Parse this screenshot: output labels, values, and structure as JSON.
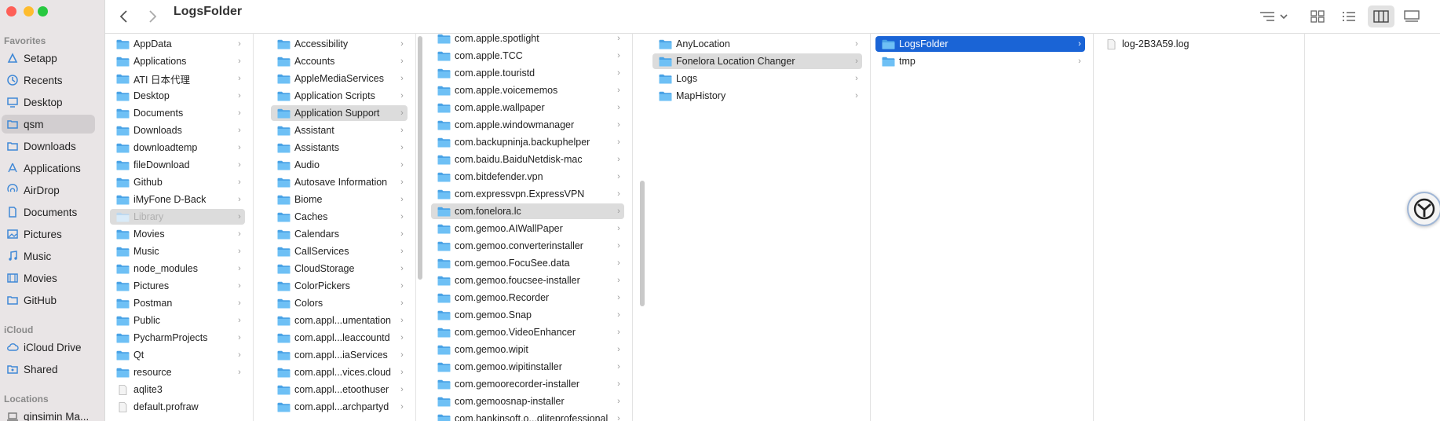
{
  "window": {
    "title": "LogsFolder"
  },
  "sidebar": {
    "favorites_label": "Favorites",
    "favorites": [
      {
        "label": "Setapp",
        "icon": "setapp-icon"
      },
      {
        "label": "Recents",
        "icon": "clock-icon"
      },
      {
        "label": "Desktop",
        "icon": "desktop-icon"
      },
      {
        "label": "qsm",
        "icon": "folder-icon",
        "selected": true
      },
      {
        "label": "Downloads",
        "icon": "folder-icon"
      },
      {
        "label": "Applications",
        "icon": "applications-icon"
      },
      {
        "label": "AirDrop",
        "icon": "airdrop-icon"
      },
      {
        "label": "Documents",
        "icon": "document-icon"
      },
      {
        "label": "Pictures",
        "icon": "picture-icon"
      },
      {
        "label": "Music",
        "icon": "music-icon"
      },
      {
        "label": "Movies",
        "icon": "movie-icon"
      },
      {
        "label": "GitHub",
        "icon": "folder-icon"
      }
    ],
    "icloud_label": "iCloud",
    "icloud": [
      {
        "label": "iCloud Drive",
        "icon": "cloud-icon"
      },
      {
        "label": "Shared",
        "icon": "shared-folder-icon"
      }
    ],
    "locations_label": "Locations",
    "locations": [
      {
        "label": "qinsimin Ma...",
        "icon": "laptop-icon"
      }
    ]
  },
  "columns": [
    {
      "items": [
        {
          "label": "AppData"
        },
        {
          "label": "Applications"
        },
        {
          "label": "ATI 日本代理"
        },
        {
          "label": "Desktop"
        },
        {
          "label": "Documents"
        },
        {
          "label": "Downloads"
        },
        {
          "label": "downloadtemp"
        },
        {
          "label": "fileDownload"
        },
        {
          "label": "Github"
        },
        {
          "label": "iMyFone D-Back"
        },
        {
          "label": "Library",
          "state": "dim-selected"
        },
        {
          "label": "Movies"
        },
        {
          "label": "Music"
        },
        {
          "label": "node_modules"
        },
        {
          "label": "Pictures"
        },
        {
          "label": "Postman"
        },
        {
          "label": "Public"
        },
        {
          "label": "PycharmProjects"
        },
        {
          "label": "Qt"
        },
        {
          "label": "resource"
        },
        {
          "label": "aqlite3",
          "type": "file"
        },
        {
          "label": "default.profraw",
          "type": "file"
        }
      ]
    },
    {
      "items": [
        {
          "label": "Accessibility"
        },
        {
          "label": "Accounts"
        },
        {
          "label": "AppleMediaServices"
        },
        {
          "label": "Application Scripts"
        },
        {
          "label": "Application Support",
          "state": "selected"
        },
        {
          "label": "Assistant"
        },
        {
          "label": "Assistants"
        },
        {
          "label": "Audio"
        },
        {
          "label": "Autosave Information"
        },
        {
          "label": "Biome"
        },
        {
          "label": "Caches"
        },
        {
          "label": "Calendars"
        },
        {
          "label": "CallServices"
        },
        {
          "label": "CloudStorage"
        },
        {
          "label": "ColorPickers"
        },
        {
          "label": "Colors"
        },
        {
          "label": "com.appl...umentation"
        },
        {
          "label": "com.appl...leaccountd"
        },
        {
          "label": "com.appl...iaServices"
        },
        {
          "label": "com.appl...vices.cloud"
        },
        {
          "label": "com.appl...etoothuser"
        },
        {
          "label": "com.appl...archpartyd"
        }
      ]
    },
    {
      "items": [
        {
          "label": "com.apple.spotlight"
        },
        {
          "label": "com.apple.TCC"
        },
        {
          "label": "com.apple.touristd"
        },
        {
          "label": "com.apple.voicememos"
        },
        {
          "label": "com.apple.wallpaper"
        },
        {
          "label": "com.apple.windowmanager"
        },
        {
          "label": "com.backupninja.backuphelper"
        },
        {
          "label": "com.baidu.BaiduNetdisk-mac"
        },
        {
          "label": "com.bitdefender.vpn"
        },
        {
          "label": "com.expressvpn.ExpressVPN"
        },
        {
          "label": "com.fonelora.lc",
          "state": "selected"
        },
        {
          "label": "com.gemoo.AIWallPaper"
        },
        {
          "label": "com.gemoo.converterinstaller"
        },
        {
          "label": "com.gemoo.FocuSee.data"
        },
        {
          "label": "com.gemoo.foucsee-installer"
        },
        {
          "label": "com.gemoo.Recorder"
        },
        {
          "label": "com.gemoo.Snap"
        },
        {
          "label": "com.gemoo.VideoEnhancer"
        },
        {
          "label": "com.gemoo.wipit"
        },
        {
          "label": "com.gemoo.wipitinstaller"
        },
        {
          "label": "com.gemoorecorder-installer"
        },
        {
          "label": "com.gemoosnap-installer"
        },
        {
          "label": "com.hankinsoft.o...qliteprofessional"
        }
      ]
    },
    {
      "items": [
        {
          "label": "AnyLocation"
        },
        {
          "label": "Fonelora Location Changer",
          "state": "selected"
        },
        {
          "label": "Logs"
        },
        {
          "label": "MapHistory"
        }
      ]
    },
    {
      "items": [
        {
          "label": "LogsFolder",
          "state": "active"
        },
        {
          "label": "tmp"
        }
      ]
    },
    {
      "items": [
        {
          "label": "log-2B3A59.log",
          "type": "file"
        }
      ]
    }
  ]
}
